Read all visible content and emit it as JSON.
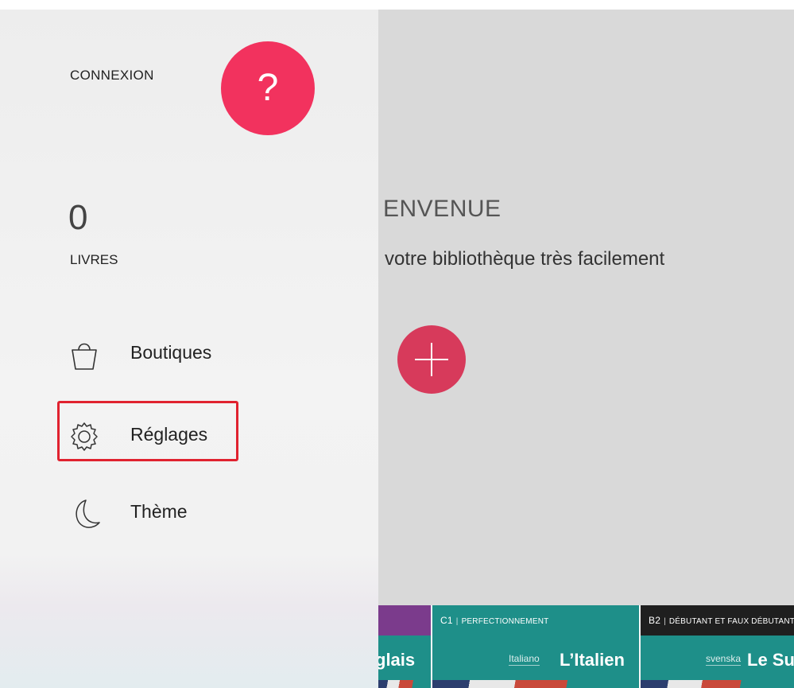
{
  "sidebar": {
    "connexion_label": "CONNEXION",
    "help_button_label": "?",
    "book_count": "0",
    "book_count_label": "LIVRES",
    "items": [
      {
        "label": "Boutiques",
        "icon": "shopping-bag-icon"
      },
      {
        "label": "Réglages",
        "icon": "gear-icon"
      },
      {
        "label": "Thème",
        "icon": "moon-icon"
      }
    ]
  },
  "main": {
    "welcome_title": "ENVENUE",
    "welcome_subtitle": "votre bibliothèque très facilement",
    "add_button_icon": "plus-icon",
    "books": [
      {
        "band_text": "",
        "level": "",
        "lang": "",
        "title": "glais"
      },
      {
        "level": "C1",
        "band_text": "PERFECTIONNEMENT",
        "lang": "Italiano",
        "title": "L’Italien"
      },
      {
        "level": "B2",
        "band_text": "DÉBUTANT ET FAUX DÉBUTANT",
        "lang": "svenska",
        "title": "Le Su"
      }
    ]
  },
  "colors": {
    "help_button": "#f2325e",
    "add_button": "#d73a5b",
    "highlight": "#e0222f",
    "book_teal": "#1e8f89"
  }
}
